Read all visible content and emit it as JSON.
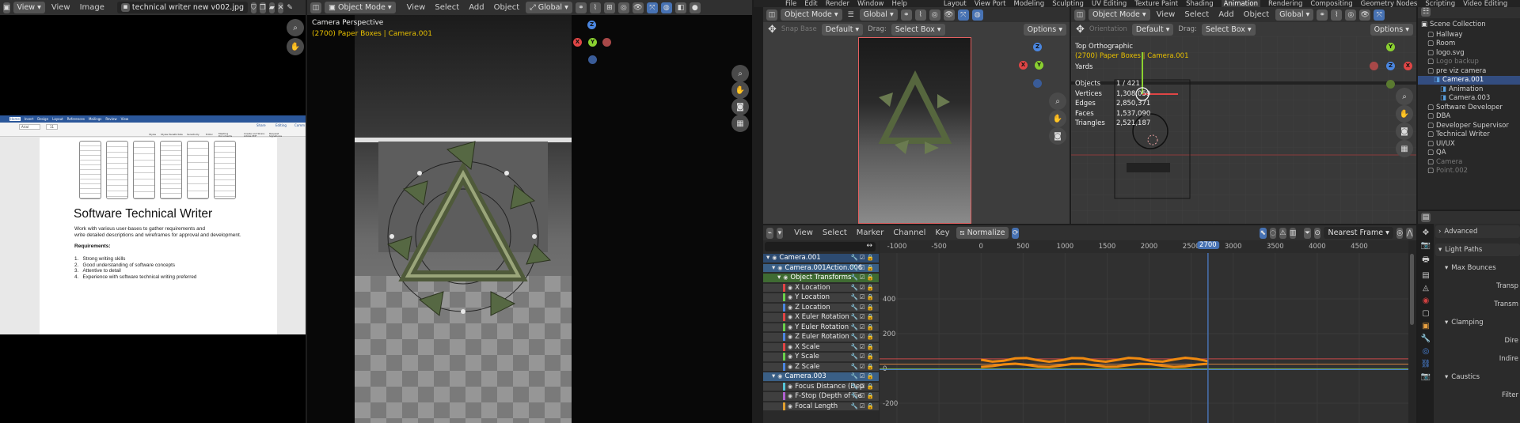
{
  "topbar": {
    "menus": [
      "File",
      "Edit",
      "Render",
      "Window",
      "Help"
    ],
    "workspaces": [
      "Layout",
      "View Port",
      "Modeling",
      "Sculpting",
      "UV Editing",
      "Texture Paint",
      "Shading",
      "Animation",
      "Rendering",
      "Compositing",
      "Geometry Nodes",
      "Scripting",
      "Video Editing"
    ],
    "active_workspace": "Animation"
  },
  "image_editor": {
    "view_label": "View",
    "menus": [
      "View",
      "Image"
    ],
    "filename": "technical writer new v002.jpg",
    "doc": {
      "ribbon_tabs": [
        "Home",
        "Insert",
        "Design",
        "Layout",
        "References",
        "Mailings",
        "Review",
        "View"
      ],
      "font": "Arial",
      "size": "11",
      "share": "Share",
      "editing": "Editing",
      "comments": "Comm",
      "ribbon_tools": [
        "Styles",
        "Styles Pane",
        "Dictate",
        "Sensitivity",
        "Editor",
        "Meeting Documents Manager",
        "Create and Share Adobe PDF",
        "Request Signatures"
      ],
      "heading": "Software Technical Writer",
      "intro1": "Work with various user-bases to gather requirements and",
      "intro2": "write detailed descriptions and wireframes for approval and development.",
      "req_title": "Requirements:",
      "requirements": [
        "Strong writing skills",
        "Good understanding of software concepts",
        "Attentive to detail",
        "Experience with software technical writing preferred"
      ]
    }
  },
  "viewport_camera": {
    "mode": "Object Mode",
    "menus": [
      "View",
      "Select",
      "Add",
      "Object"
    ],
    "orientation": "Global",
    "title": "Camera Perspective",
    "subtitle": "(2700) Paper Boxes | Camera.001"
  },
  "viewport_top": {
    "mode": "Object Mode",
    "menus": [
      "View",
      "Select",
      "Add",
      "Object"
    ],
    "orientation": "Global",
    "orientation_label": "Orientation",
    "orientation_value": "Default",
    "drag_label": "Drag:",
    "drag_value": "Select Box",
    "options": "Options",
    "left_mode": "Object Mode",
    "left_orientation": "Global",
    "left_default": "Default",
    "left_drag": "Drag:",
    "left_selectbox": "Select Box",
    "left_options": "Options",
    "left_snap": "Snap Base",
    "title": "Top Orthographic",
    "subtitle": "(2700) Paper Boxes | Camera.001",
    "units": "Yards",
    "stats": [
      {
        "label": "Objects",
        "value": "1 / 421"
      },
      {
        "label": "Vertices",
        "value": "1,308,059"
      },
      {
        "label": "Edges",
        "value": "2,850,371"
      },
      {
        "label": "Faces",
        "value": "1,537,090"
      },
      {
        "label": "Triangles",
        "value": "2,521,187"
      }
    ]
  },
  "graph_editor": {
    "menus": [
      "View",
      "Select",
      "Marker",
      "Channel",
      "Key"
    ],
    "normalize": "Normalize",
    "interp": "Nearest Frame",
    "frame_ticks": [
      "-1000",
      "-500",
      "0",
      "500",
      "1000",
      "1500",
      "2000",
      "2500",
      "3000",
      "3500",
      "4000",
      "4500"
    ],
    "current_frame": "2700",
    "y_ticks": [
      "400",
      "200",
      "0",
      "-200"
    ],
    "channels": [
      {
        "name": "Camera.001",
        "level": 0,
        "bg": "#2d4b71",
        "color": "#ffffff"
      },
      {
        "name": "Camera.001Action.006",
        "level": 1,
        "bg": "#3a5f86",
        "color": "#ffffff"
      },
      {
        "name": "Object Transforms",
        "level": 2,
        "bg": "#3f6b32",
        "color": "#ffffff"
      },
      {
        "name": "X Location",
        "level": 3,
        "bg": "#3f3f3f",
        "color": "#e6e6e6",
        "swatch": "#e04545"
      },
      {
        "name": "Y Location",
        "level": 3,
        "bg": "#3f3f3f",
        "color": "#e6e6e6",
        "swatch": "#6ad04a"
      },
      {
        "name": "Z Location",
        "level": 3,
        "bg": "#3f3f3f",
        "color": "#e6e6e6",
        "swatch": "#4a86e0"
      },
      {
        "name": "X Euler Rotation",
        "level": 3,
        "bg": "#3f3f3f",
        "color": "#e6e6e6",
        "swatch": "#e04545"
      },
      {
        "name": "Y Euler Rotation",
        "level": 3,
        "bg": "#3f3f3f",
        "color": "#e6e6e6",
        "swatch": "#6ad04a"
      },
      {
        "name": "Z Euler Rotation",
        "level": 3,
        "bg": "#3f3f3f",
        "color": "#e6e6e6",
        "swatch": "#4a86e0"
      },
      {
        "name": "X Scale",
        "level": 3,
        "bg": "#3f3f3f",
        "color": "#e6e6e6",
        "swatch": "#e04545"
      },
      {
        "name": "Y Scale",
        "level": 3,
        "bg": "#3f3f3f",
        "color": "#e6e6e6",
        "swatch": "#6ad04a"
      },
      {
        "name": "Z Scale",
        "level": 3,
        "bg": "#3f3f3f",
        "color": "#e6e6e6",
        "swatch": "#4a86e0"
      },
      {
        "name": "Camera.003",
        "level": 1,
        "bg": "#3a5f86",
        "color": "#ffffff"
      },
      {
        "name": "Focus Distance (Dep",
        "level": 3,
        "bg": "#3f3f3f",
        "color": "#e6e6e6",
        "swatch": "#55c6d8"
      },
      {
        "name": "F-Stop (Depth of Fie",
        "level": 3,
        "bg": "#3f3f3f",
        "color": "#e6e6e6",
        "swatch": "#b060d0"
      },
      {
        "name": "Focal Length",
        "level": 3,
        "bg": "#3f3f3f",
        "color": "#e6e6e6",
        "swatch": "#e0a030"
      }
    ]
  },
  "outliner": {
    "root": "Scene Collection",
    "items": [
      {
        "name": "Hallway",
        "level": 1
      },
      {
        "name": "Room",
        "level": 1
      },
      {
        "name": "logo.svg",
        "level": 1
      },
      {
        "name": "Logo backup",
        "level": 1,
        "dim": true
      },
      {
        "name": "pre viz camera",
        "level": 1
      },
      {
        "name": "Camera.001",
        "level": 2,
        "selected": true
      },
      {
        "name": "Animation",
        "level": 3
      },
      {
        "name": "Camera.003",
        "level": 3
      },
      {
        "name": "Software Developer",
        "level": 1
      },
      {
        "name": "DBA",
        "level": 1
      },
      {
        "name": "Developer Supervisor",
        "level": 1
      },
      {
        "name": "Technical Writer",
        "level": 1
      },
      {
        "name": "UI/UX",
        "level": 1
      },
      {
        "name": "QA",
        "level": 1
      },
      {
        "name": "Camera",
        "level": 1,
        "dim": true
      },
      {
        "name": "Point.002",
        "level": 1,
        "dim": true
      }
    ]
  },
  "properties": {
    "sections": [
      {
        "name": "Advanced",
        "level": 0
      },
      {
        "name": "Light Paths",
        "level": 0
      },
      {
        "name": "Max Bounces",
        "level": 1
      },
      {
        "name": "Transp",
        "level": 2,
        "value": true
      },
      {
        "name": "Transm",
        "level": 2,
        "value": true
      },
      {
        "name": "Clamping",
        "level": 1
      },
      {
        "name": "Dire",
        "level": 2,
        "value": true
      },
      {
        "name": "Indire",
        "level": 2,
        "value": true
      },
      {
        "name": "Caustics",
        "level": 1
      },
      {
        "name": "Filter",
        "level": 2,
        "value": true
      }
    ]
  }
}
